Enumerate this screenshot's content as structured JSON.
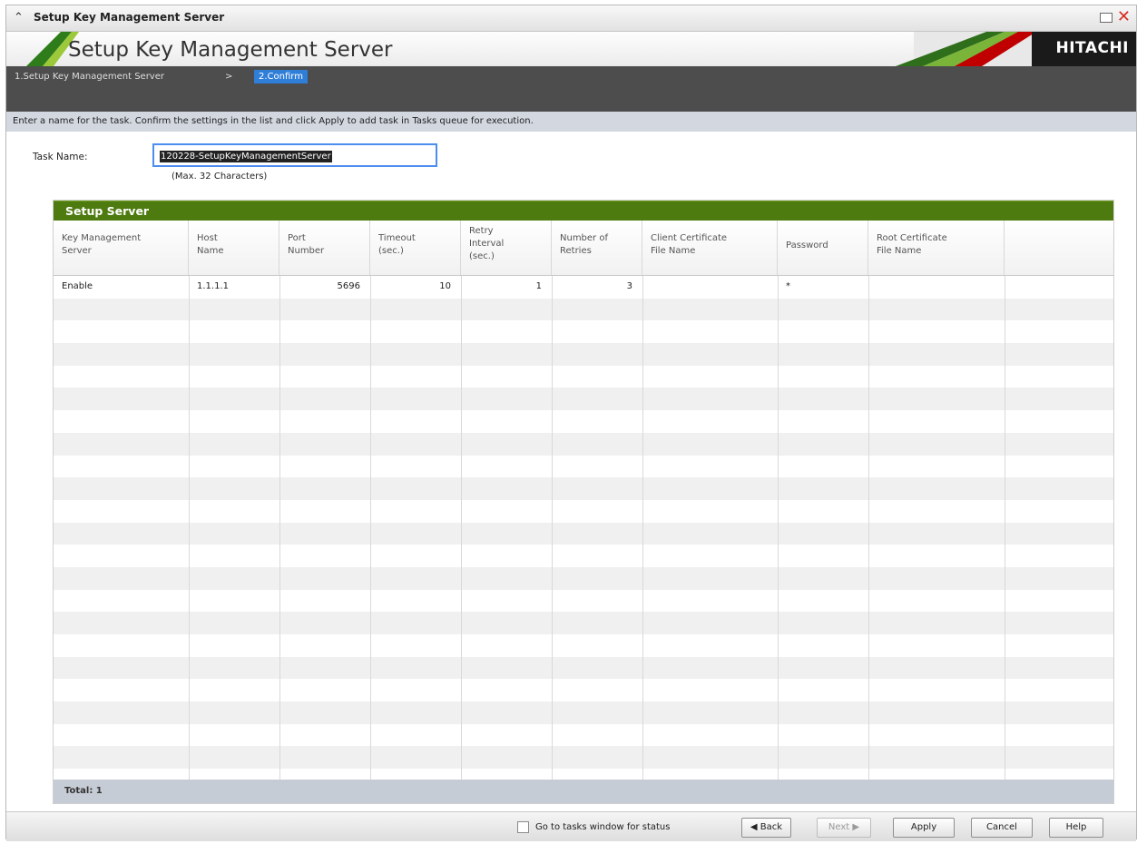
{
  "window": {
    "title": "Setup Key Management Server"
  },
  "banner": {
    "title": "Setup Key Management Server",
    "logo": "HITACHI"
  },
  "steps": {
    "step1": "1.Setup Key Management Server",
    "separator": ">",
    "step2": "2.Confirm"
  },
  "instruction": "Enter a name for the task. Confirm the settings in the list and click Apply to add task in Tasks queue for execution.",
  "task": {
    "label": "Task Name:",
    "value": "120228-SetupKeyManagementServer",
    "hint": "(Max. 32 Characters)"
  },
  "table": {
    "title": "Setup Server",
    "columns": [
      [
        "Key Management",
        "Server"
      ],
      [
        "Host",
        "Name"
      ],
      [
        "Port",
        "Number"
      ],
      [
        "Timeout",
        "(sec.)"
      ],
      [
        "Retry",
        "Interval",
        "(sec.)"
      ],
      [
        "Number of",
        "Retries"
      ],
      [
        "Client Certificate",
        "File Name"
      ],
      [
        "Password"
      ],
      [
        "Root Certificate",
        "File Name"
      ]
    ],
    "rows": [
      [
        "Enable",
        "1.1.1.1",
        "5696",
        "10",
        "1",
        "3",
        "",
        "*",
        ""
      ]
    ],
    "total": "Total:  1"
  },
  "actions": {
    "goto_tasks": "Go to tasks window for status",
    "back": "◀ Back",
    "next": "Next ▶",
    "apply": "Apply",
    "cancel": "Cancel",
    "help": "Help"
  }
}
